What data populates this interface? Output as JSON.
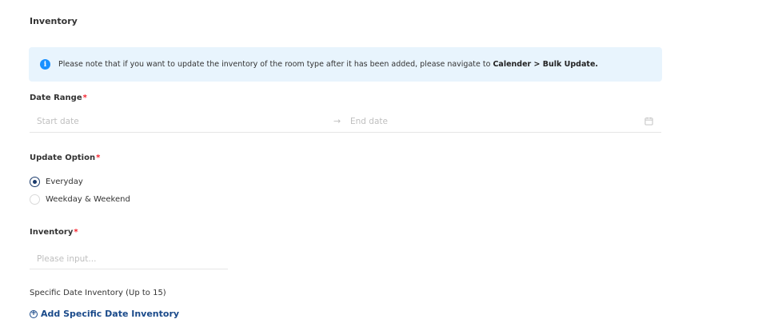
{
  "section": {
    "title": "Inventory"
  },
  "alert": {
    "text": "Please note that if you want to update the inventory of the room type after it has been added, please navigate to ",
    "bold": "Calender > Bulk Update."
  },
  "date_range": {
    "label": "Date Range",
    "start_placeholder": "Start date",
    "arrow": "→",
    "end_placeholder": "End date",
    "icon": "calendar-icon"
  },
  "update_option": {
    "label": "Update Option",
    "options": [
      {
        "label": "Everyday",
        "checked": true
      },
      {
        "label": "Weekday & Weekend",
        "checked": false
      }
    ]
  },
  "inventory": {
    "label": "Inventory",
    "placeholder": "Please input...",
    "value": ""
  },
  "specific": {
    "label": "Specific Date Inventory (Up to 15)",
    "add_label": "Add Specific Date Inventory",
    "add_icon": "plus-circle-icon"
  },
  "required_mark": "*",
  "colors": {
    "accent": "#1a3a6b",
    "link": "#1a4a8a",
    "required": "#f5222d",
    "info": "#1890ff",
    "alert_bg": "#e8f4fd"
  }
}
